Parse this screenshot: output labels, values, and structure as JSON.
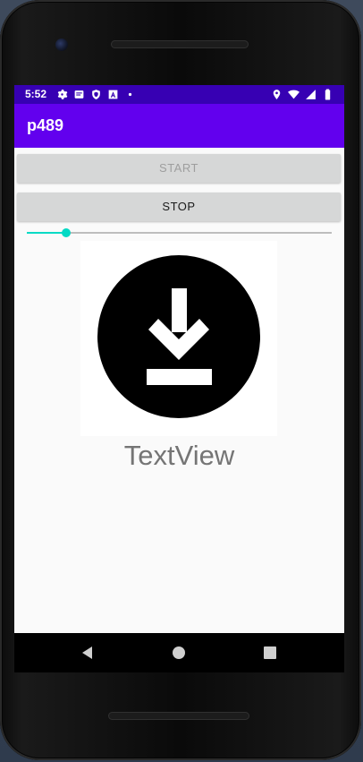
{
  "status_bar": {
    "time": "5:52",
    "left_icons": [
      "settings-icon",
      "notification-icon",
      "shield-icon",
      "text-a-icon",
      "dot-icon"
    ],
    "right_icons": [
      "location-icon",
      "wifi-icon",
      "signal-icon",
      "battery-icon"
    ],
    "color": "#3700b3"
  },
  "app_bar": {
    "title": "p489",
    "color": "#6200ee"
  },
  "buttons": {
    "start_label": "START",
    "stop_label": "STOP"
  },
  "seekbar": {
    "progress": 0.13,
    "accent_color": "#03dac5"
  },
  "image": {
    "icon": "download-circle-icon"
  },
  "textview": {
    "text": "TextView"
  },
  "nav_bar": {
    "items": [
      "back-icon",
      "home-icon",
      "recents-icon"
    ]
  }
}
